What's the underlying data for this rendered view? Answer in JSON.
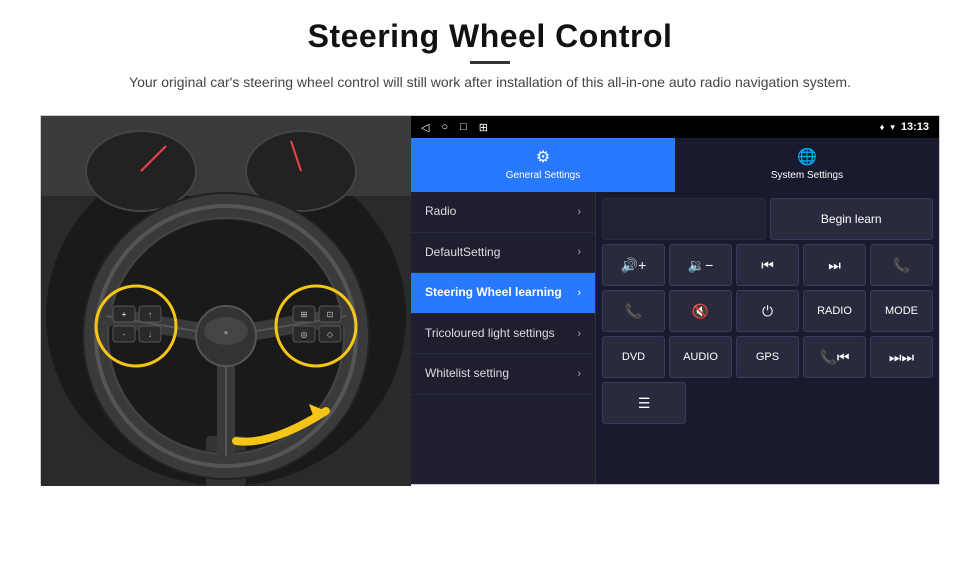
{
  "header": {
    "title": "Steering Wheel Control",
    "subtitle": "Your original car's steering wheel control will still work after installation of this all-in-one auto radio navigation system."
  },
  "status_bar": {
    "back_icon": "◁",
    "home_icon": "○",
    "square_icon": "□",
    "grid_icon": "⊞",
    "gps_icon": "♦",
    "wifi_icon": "▾",
    "time": "13:13"
  },
  "tabs": [
    {
      "id": "general",
      "label": "General Settings",
      "icon": "⚙",
      "active": true
    },
    {
      "id": "system",
      "label": "System Settings",
      "icon": "🌐",
      "active": false
    }
  ],
  "menu_items": [
    {
      "id": "radio",
      "label": "Radio",
      "active": false
    },
    {
      "id": "default",
      "label": "DefaultSetting",
      "active": false
    },
    {
      "id": "steering",
      "label": "Steering Wheel learning",
      "active": true
    },
    {
      "id": "tricoloured",
      "label": "Tricoloured light settings",
      "active": false
    },
    {
      "id": "whitelist",
      "label": "Whitelist setting",
      "active": false
    }
  ],
  "control_panel": {
    "row1": {
      "empty_label": "",
      "begin_learn_label": "Begin learn"
    },
    "row2": {
      "vol_up": "🔊+",
      "vol_down": "🔉-",
      "prev_track": "⏮",
      "next_track": "⏭",
      "phone": "📞"
    },
    "row3": {
      "answer": "📞",
      "mute": "🔇",
      "power": "⏻",
      "radio": "RADIO",
      "mode": "MODE"
    },
    "row4": {
      "dvd": "DVD",
      "audio": "AUDIO",
      "gps": "GPS",
      "phone_prev": "📞⏮",
      "skip": "⏭"
    },
    "row5": {
      "list": "☰"
    }
  }
}
